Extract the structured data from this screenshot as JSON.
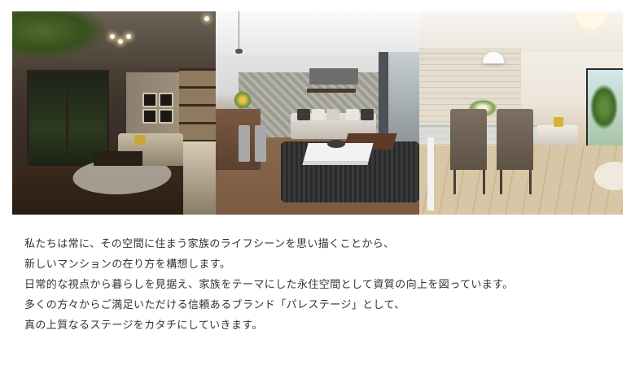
{
  "gallery": {
    "photos": [
      {
        "name": "living-room-photo"
      },
      {
        "name": "modern-living-room-photo"
      },
      {
        "name": "dining-room-photo"
      }
    ]
  },
  "copy": {
    "lines": [
      "私たちは常に、その空間に住まう家族のライフシーンを思い描くことから、",
      "新しいマンションの在り方を構想します。",
      "日常的な視点から暮らしを見据え、家族をテーマにした永住空間として資質の向上を図っています。",
      "多くの方々からご満足いただける信頼あるブランド「パレステージ」として、",
      "真の上質なるステージをカタチにしていきます。"
    ]
  },
  "colors": {
    "text": "#333333",
    "background": "#ffffff"
  }
}
